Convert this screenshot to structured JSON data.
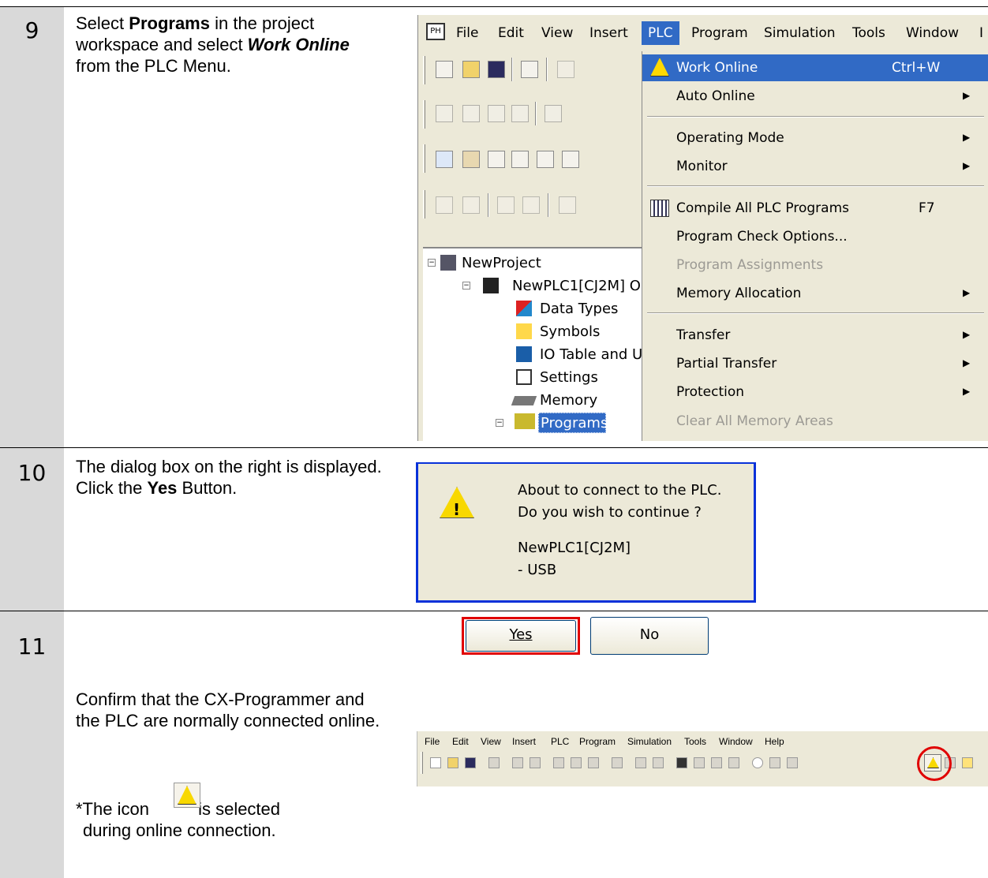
{
  "steps": [
    {
      "number": "9",
      "desc_parts": [
        "Select ",
        "Programs",
        " in the project workspace and select ",
        "Work Online",
        " from the PLC Menu."
      ]
    },
    {
      "number": "10",
      "desc_parts": [
        "The dialog box on the right is displayed. Click the ",
        "Yes",
        " Button."
      ]
    },
    {
      "number": "11",
      "desc": "Confirm that the CX-Programmer and the PLC are normally connected online.",
      "note_prefix": "*The icon",
      "note_suffix": "is selected",
      "note_line2": "during online connection."
    }
  ],
  "app": {
    "menubar": [
      "File",
      "Edit",
      "View",
      "Insert",
      "PLC",
      "Program",
      "Simulation",
      "Tools",
      "Window"
    ],
    "active_menu": "PLC",
    "plc_menu": [
      {
        "label": "Work Online",
        "shortcut": "Ctrl+W",
        "icon": "warning-online-icon",
        "highlight": true
      },
      {
        "label": "Auto Online",
        "submenu": true
      },
      {
        "label": "Operating Mode",
        "submenu": true
      },
      {
        "label": "Monitor",
        "submenu": true
      },
      {
        "label": "Compile All PLC Programs",
        "shortcut": "F7",
        "icon": "compile-icon"
      },
      {
        "label": "Program Check Options...",
        "submenu": false
      },
      {
        "label": "Program Assignments",
        "disabled": true
      },
      {
        "label": "Memory Allocation",
        "submenu": true
      },
      {
        "label": "Transfer",
        "submenu": true
      },
      {
        "label": "Partial Transfer",
        "submenu": true
      },
      {
        "label": "Protection",
        "submenu": true
      },
      {
        "label": "Clear All Memory Areas",
        "disabled": true
      }
    ],
    "tree": {
      "project": "NewProject",
      "plc": "NewPLC1[CJ2M] O",
      "children": [
        "Data Types",
        "Symbols",
        "IO Table and U",
        "Settings",
        "Memory",
        "Programs"
      ]
    }
  },
  "dialog": {
    "line1": "About to connect to the PLC.",
    "line2": "Do you wish to continue ?",
    "line3": "NewPLC1[CJ2M]",
    "line4": "- USB",
    "yes": "Yes",
    "no": "No"
  },
  "toolbar_small": {
    "menus": [
      "File",
      "Edit",
      "View",
      "Insert",
      "PLC",
      "Program",
      "Simulation",
      "Tools",
      "Window",
      "Help"
    ]
  },
  "colors": {
    "highlight": "#316ac5",
    "step_column": "#d9d9d9",
    "callout_red": "#e00000",
    "warning_yellow": "#f8d800"
  }
}
